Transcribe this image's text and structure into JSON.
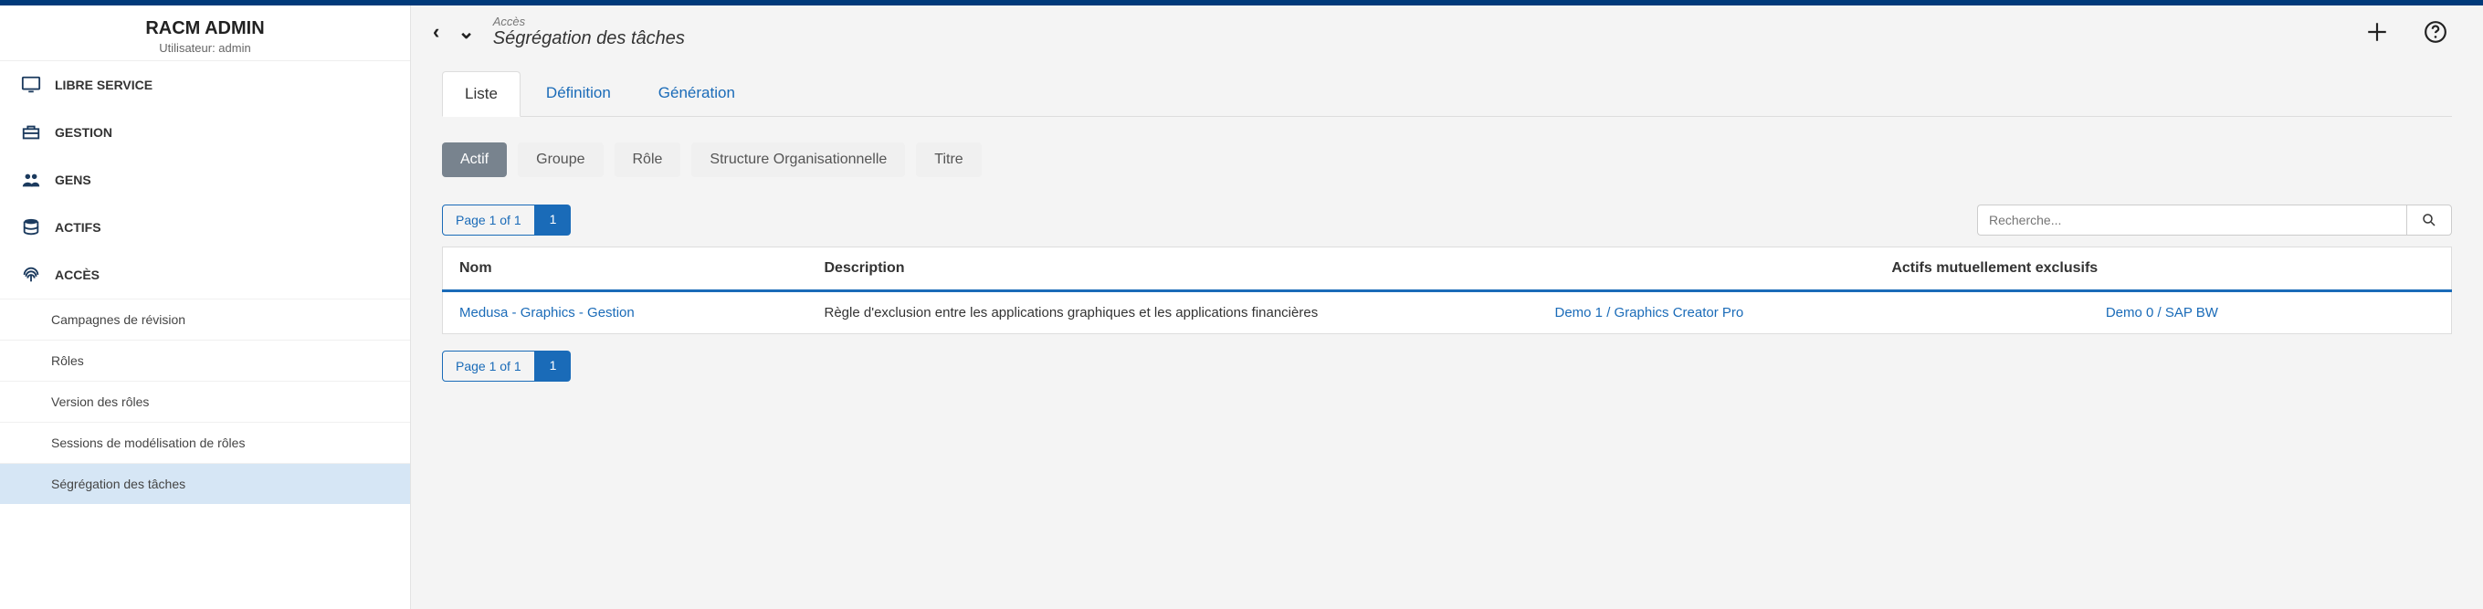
{
  "sidebar": {
    "title": "RACM ADMIN",
    "user": "Utilisateur: admin",
    "items": [
      {
        "label": "LIBRE SERVICE"
      },
      {
        "label": "GESTION"
      },
      {
        "label": "GENS"
      },
      {
        "label": "ACTIFS"
      },
      {
        "label": "ACCÈS"
      }
    ],
    "submenu": [
      {
        "label": "Campagnes de révision"
      },
      {
        "label": "Rôles"
      },
      {
        "label": "Version des rôles"
      },
      {
        "label": "Sessions de modélisation de rôles"
      },
      {
        "label": "Ségrégation des tâches"
      }
    ]
  },
  "header": {
    "crumb": "Accès",
    "page": "Ségrégation des tâches"
  },
  "tabs": [
    {
      "label": "Liste",
      "active": true
    },
    {
      "label": "Définition"
    },
    {
      "label": "Génération"
    }
  ],
  "pills": [
    {
      "label": "Actif",
      "active": true
    },
    {
      "label": "Groupe"
    },
    {
      "label": "Rôle"
    },
    {
      "label": "Structure Organisationnelle"
    },
    {
      "label": "Titre"
    }
  ],
  "pager": {
    "info": "Page 1 of 1",
    "current": "1"
  },
  "search": {
    "placeholder": "Recherche..."
  },
  "table": {
    "headers": {
      "name": "Nom",
      "desc": "Description",
      "assets": "Actifs mutuellement exclusifs"
    },
    "rows": [
      {
        "name": "Medusa - Graphics - Gestion",
        "desc": "Règle d'exclusion entre les applications graphiques et les applications financières",
        "asset1": "Demo 1 / Graphics Creator Pro",
        "asset2": "Demo 0 / SAP BW"
      }
    ]
  }
}
